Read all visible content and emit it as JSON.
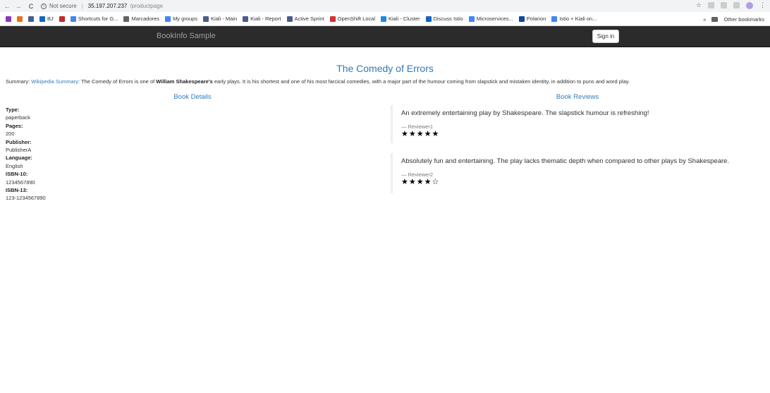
{
  "browser": {
    "back": "←",
    "forward": "→",
    "refresh": "C",
    "security": "Not secure",
    "url_host": "35.197.207.237",
    "url_path": "/productpage",
    "star": "☆",
    "menu": "⋮"
  },
  "bookmarks": {
    "items": [
      {
        "label": "",
        "color": "#8a3ab9",
        "icon": "mail-icon"
      },
      {
        "label": "",
        "color": "#e8711a",
        "icon": "app-icon"
      },
      {
        "label": "",
        "color": "#4a5d8a",
        "icon": "app-icon"
      },
      {
        "label": "BJ",
        "color": "#1565c0",
        "icon": "bj-icon"
      },
      {
        "label": "",
        "color": "#c62828",
        "icon": "app-icon"
      },
      {
        "label": "Shortcuts for G...",
        "color": "#4285f4",
        "icon": "google-icon"
      },
      {
        "label": "Marcadores",
        "color": "#5f6368",
        "icon": "folder-icon"
      },
      {
        "label": "My groups",
        "color": "#4285f4",
        "icon": "groups-icon"
      },
      {
        "label": "Kiali - Main",
        "color": "#4a5d8a",
        "icon": "kiali-icon"
      },
      {
        "label": "Kiali - Report",
        "color": "#4a5d8a",
        "icon": "kiali-icon"
      },
      {
        "label": "Active Sprint",
        "color": "#4a5d8a",
        "icon": "jira-icon"
      },
      {
        "label": "OpenShift Local",
        "color": "#d32f2f",
        "icon": "openshift-icon"
      },
      {
        "label": "Kiali - Cluster",
        "color": "#1e88e5",
        "icon": "kiali-icon"
      },
      {
        "label": "Discuss Istio",
        "color": "#1565c0",
        "icon": "istio-icon"
      },
      {
        "label": "Microservices...",
        "color": "#4285f4",
        "icon": "docs-icon"
      },
      {
        "label": "Polarion",
        "color": "#0d47a1",
        "icon": "polarion-icon"
      },
      {
        "label": "Istio + Kiali on...",
        "color": "#4285f4",
        "icon": "docs-icon"
      }
    ],
    "more": "»",
    "other": "Other bookmarks"
  },
  "navbar": {
    "brand": "BookInfo Sample",
    "sign_in": "Sign in"
  },
  "product": {
    "title": "The Comedy of Errors",
    "summary_prefix": "Summary: ",
    "summary_link": "Wikipedia Summary",
    "summary_mid": ": The Comedy of Errors is one of ",
    "summary_author": "William Shakespeare's",
    "summary_rest": " early plays. It is his shortest and one of his most farcical comedies, with a major part of the humour coming from slapstick and mistaken identity, in addition to puns and word play."
  },
  "details": {
    "heading": "Book Details",
    "fields": [
      {
        "label": "Type:",
        "value": "paperback"
      },
      {
        "label": "Pages:",
        "value": "200"
      },
      {
        "label": "Publisher:",
        "value": "PublisherA"
      },
      {
        "label": "Language:",
        "value": "English"
      },
      {
        "label": "ISBN-10:",
        "value": "1234567890"
      },
      {
        "label": "ISBN-13:",
        "value": "123-1234567890"
      }
    ]
  },
  "reviews": {
    "heading": "Book Reviews",
    "items": [
      {
        "text": "An extremely entertaining play by Shakespeare. The slapstick humour is refreshing!",
        "reviewer": "— Reviewer1",
        "stars": "★★★★★",
        "rating": 5
      },
      {
        "text": "Absolutely fun and entertaining. The play lacks thematic depth when compared to other plays by Shakespeare.",
        "reviewer": "— Reviewer2",
        "stars": "★★★★☆",
        "rating": 4
      }
    ]
  }
}
